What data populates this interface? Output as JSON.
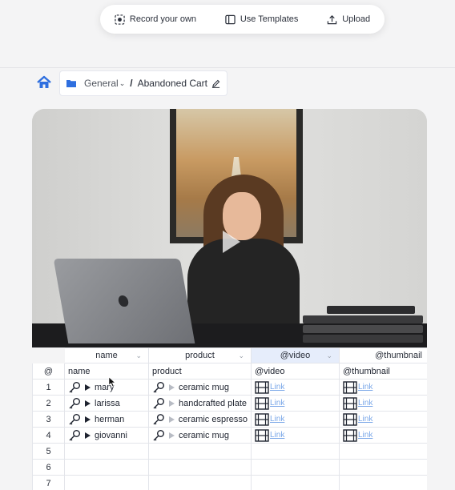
{
  "toolbar": {
    "record_label": "Record your own",
    "templates_label": "Use Templates",
    "upload_label": "Upload"
  },
  "breadcrumb": {
    "folder": "General",
    "separator": "/",
    "current": "Abandoned Cart"
  },
  "table": {
    "top_headers": [
      "name",
      "product",
      "@video",
      "@thumbnail"
    ],
    "col_headers": [
      "@",
      "name",
      "product",
      "@video",
      "@thumbnail"
    ],
    "rows": [
      {
        "num": "1",
        "name": "mary",
        "product": "ceramic mug",
        "video_link": "Link",
        "thumb_link": "Link"
      },
      {
        "num": "2",
        "name": "larissa",
        "product": "handcrafted plate",
        "video_link": "Link",
        "thumb_link": "Link"
      },
      {
        "num": "3",
        "name": "herman",
        "product": "ceramic espresso",
        "video_link": "Link",
        "thumb_link": "Link"
      },
      {
        "num": "4",
        "name": "giovanni",
        "product": "ceramic mug",
        "video_link": "Link",
        "thumb_link": "Link"
      }
    ],
    "empty_rows": [
      "5",
      "6",
      "7"
    ]
  },
  "colors": {
    "accent": "#2f6fdf",
    "link": "#7aa7e8",
    "selected_header": "#e6edfb"
  },
  "icons": {
    "record": "record-icon",
    "templates": "templates-icon",
    "upload": "upload-icon",
    "home": "home-icon",
    "folder": "folder-icon",
    "edit": "pencil-icon",
    "play": "play-icon",
    "key": "key-icon",
    "film": "film-icon"
  }
}
